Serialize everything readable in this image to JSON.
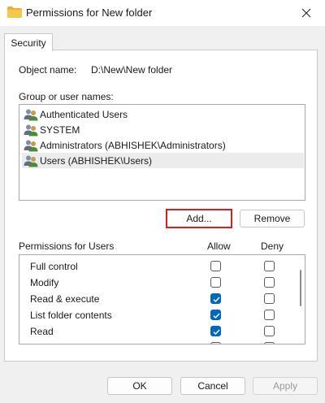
{
  "window": {
    "title": "Permissions for New folder",
    "close_glyph": "✕"
  },
  "tabs": [
    {
      "label": "Security",
      "active": true
    }
  ],
  "object": {
    "label": "Object name:",
    "value": "D:\\New\\New folder"
  },
  "group_list": {
    "label": "Group or user names:",
    "items": [
      {
        "name": "Authenticated Users",
        "icon": "users-group-icon",
        "selected": false
      },
      {
        "name": "SYSTEM",
        "icon": "users-group-icon",
        "selected": false
      },
      {
        "name": "Administrators (ABHISHEK\\Administrators)",
        "icon": "users-group-icon",
        "selected": false
      },
      {
        "name": "Users (ABHISHEK\\Users)",
        "icon": "users-group-icon",
        "selected": true
      }
    ]
  },
  "buttons": {
    "add": "Add...",
    "remove": "Remove",
    "ok": "OK",
    "cancel": "Cancel",
    "apply": "Apply"
  },
  "permissions": {
    "header": "Permissions for Users",
    "allow_label": "Allow",
    "deny_label": "Deny",
    "rows": [
      {
        "name": "Full control",
        "allow": false,
        "deny": false
      },
      {
        "name": "Modify",
        "allow": false,
        "deny": false
      },
      {
        "name": "Read & execute",
        "allow": true,
        "deny": false
      },
      {
        "name": "List folder contents",
        "allow": true,
        "deny": false
      },
      {
        "name": "Read",
        "allow": true,
        "deny": false
      },
      {
        "name": "",
        "allow": false,
        "deny": false
      }
    ]
  },
  "colors": {
    "accent": "#0067c0",
    "highlight_border": "#d42020",
    "folder": "#f2c14e"
  }
}
